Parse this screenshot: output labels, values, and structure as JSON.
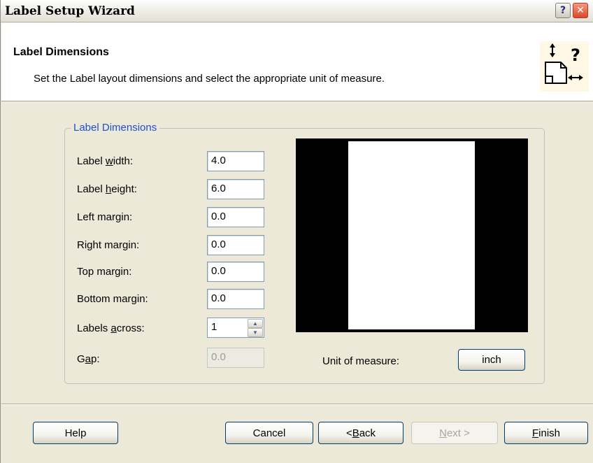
{
  "window": {
    "title": "Label Setup Wizard",
    "help_glyph": "?",
    "close_glyph": "✕"
  },
  "header": {
    "title": "Label Dimensions",
    "subtitle": "Set the Label layout dimensions and select the appropriate unit of measure.",
    "icon": "label-dimensions-help-icon"
  },
  "group": {
    "legend": "Label Dimensions",
    "fields": [
      {
        "label_pre": "Label ",
        "label_u": "w",
        "label_post": "idth:",
        "value": "4.0"
      },
      {
        "label_pre": "Label ",
        "label_u": "h",
        "label_post": "eight:",
        "value": "6.0"
      },
      {
        "label_pre": "Left margin:",
        "label_u": "",
        "label_post": "",
        "value": "0.0"
      },
      {
        "label_pre": "Right margin:",
        "label_u": "",
        "label_post": "",
        "value": "0.0"
      },
      {
        "label_pre": "Top margin:",
        "label_u": "",
        "label_post": "",
        "value": "0.0"
      },
      {
        "label_pre": "Bottom margin:",
        "label_u": "",
        "label_post": "",
        "value": "0.0"
      }
    ],
    "labels_across": {
      "label_pre": "Labels ",
      "label_u": "a",
      "label_post": "cross:",
      "value": "1"
    },
    "gap": {
      "label_pre": "G",
      "label_u": "a",
      "label_post": "p:",
      "value": "0.0"
    },
    "unit_label": "Unit of measure:",
    "unit_button": "inch"
  },
  "buttons": {
    "help": "Help",
    "cancel": "Cancel",
    "back_pre": "< ",
    "back_u": "B",
    "back_post": "ack",
    "next_u": "N",
    "next_post": "ext >",
    "finish_u": "F",
    "finish_post": "inish"
  },
  "colors": {
    "dialog_bg": "#ECE9D8",
    "legend_text": "#1F4FCF",
    "preview_bg": "#000000",
    "label_paper": "#FFFFFF"
  }
}
